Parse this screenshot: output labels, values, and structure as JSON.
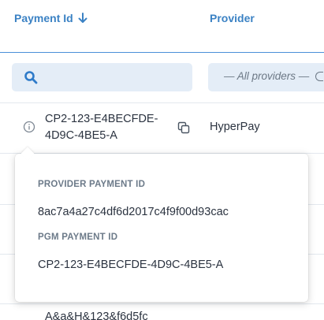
{
  "table": {
    "columns": {
      "payment_id": "Payment Id",
      "provider": "Provider"
    },
    "sort": {
      "column": "payment_id",
      "direction": "descending",
      "icon": "arrow-down-icon"
    },
    "filters": {
      "search_placeholder": "",
      "provider_placeholder": "— All providers —"
    },
    "rows": [
      {
        "payment_id": "CP2-123-E4BECFDE-4D9C-4BE5-A",
        "provider": "HyperPay"
      },
      {
        "payment_id": "A&a&H&123&f6d5fc",
        "provider": ""
      }
    ]
  },
  "popover": {
    "provider_payment_label": "PROVIDER PAYMENT ID",
    "provider_payment_value": "8ac7a4a27c4df6d2017c4f9f00d93cac",
    "pgm_payment_label": "PGM PAYMENT ID",
    "pgm_payment_value": "CP2-123-E4BECFDE-4D9C-4BE5-A"
  },
  "colors": {
    "accent": "#3b82c4",
    "filter_bg": "#e4edf7",
    "text": "#2b3340",
    "muted_label": "#6c7a89"
  }
}
